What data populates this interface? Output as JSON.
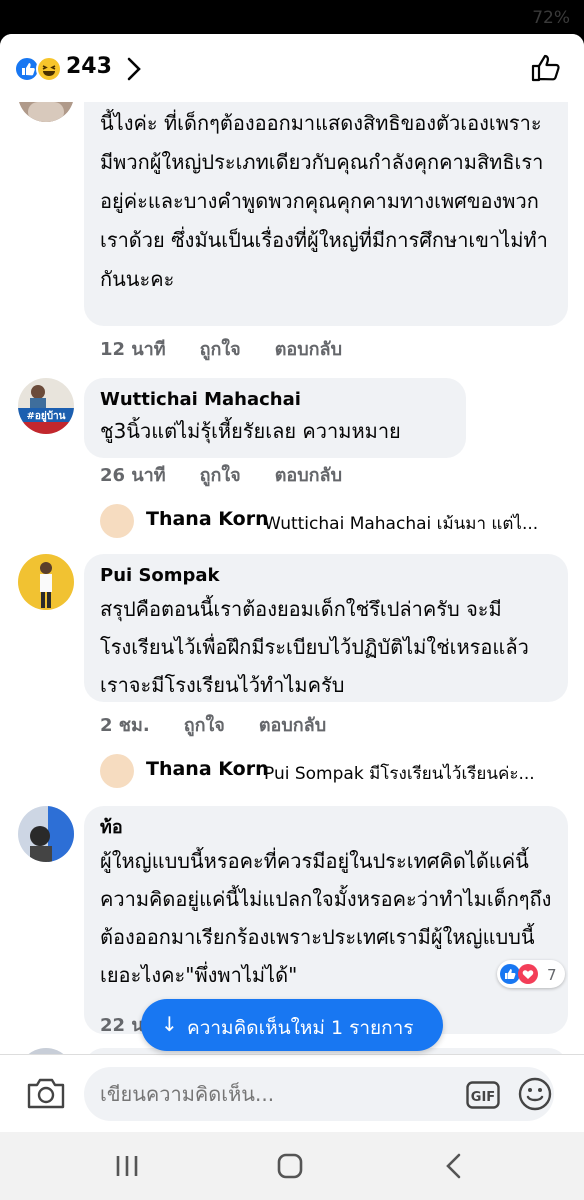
{
  "status": {
    "battery": "72%"
  },
  "header": {
    "reaction_count": "243"
  },
  "comments": [
    {
      "name": "",
      "text": "นี้ไงค่ะ ที่เด็กๆต้องออกมาแสดงสิทธิของตัวเองเพราะมีพวกผู้ใหญ่ประเภทเดียวกับคุณกำลังคุกคามสิทธิเราอยู่ค่ะและบางคำพูดพวกคุณคุกคามทางเพศของพวกเราด้วย ซึ่งมันเป็นเรื่องที่ผู้ใหญ่ที่มีการศึกษาเขาไม่ทำกันนะคะ",
      "time": "12 นาที",
      "like": "ถูกใจ",
      "reply": "ตอบกลับ"
    },
    {
      "name": "Wuttichai Mahachai",
      "text": "ชู3นิ้วแต่ไม่รุ้เหี้ยรัยเลย ความหมาย",
      "time": "26 นาที",
      "like": "ถูกใจ",
      "reply": "ตอบกลับ",
      "avatar_text": "#อยู่บ้าน",
      "reply_preview": {
        "name": "Thana Korn",
        "text": "Wuttichai Mahachai เม้นมา แต่ไ..."
      }
    },
    {
      "name": "Pui Sompak",
      "text": "สรุปคือตอนนี้เราต้องยอมเด็กใช่รึเปล่าครับ จะมีโรงเรียนไว้เพื่อฝึกมีระเบียบไว้ปฏิบัติไม่ใช่เหรอแล้วเราจะมีโรงเรียนไว้ทำไมครับ",
      "time": "2 ชม.",
      "like": "ถูกใจ",
      "reply": "ตอบกลับ",
      "reply_preview": {
        "name": "Thana Korn",
        "text": "Pui Sompak มีโรงเรียนไว้เรียนค่ะ..."
      }
    },
    {
      "name": "ท้อ",
      "text": "ผู้ใหญ่แบบนี้หรอคะที่ควรมีอยู่ในประเทศคิดได้แค่นี้ความคิดอยู่แค่นี้ไม่แปลกใจมั้งหรอคะว่าทำไมเด็กๆถึงต้องออกมาเรียกร้องเพราะประเทศเรามีผู้ใหญ่แบบนี้เยอะไงคะ\"พึ่งพาไม่ได้\"",
      "time": "22 น",
      "reaction_count": "7"
    }
  ],
  "new_comments_button": "ความคิดเห็นใหม่ 1 รายการ",
  "composer": {
    "placeholder": "เขียนความคิดเห็น...",
    "gif": "GIF"
  },
  "colors": {
    "accent": "#1877f2",
    "bubble": "#f0f2f5",
    "love": "#f33e58"
  }
}
